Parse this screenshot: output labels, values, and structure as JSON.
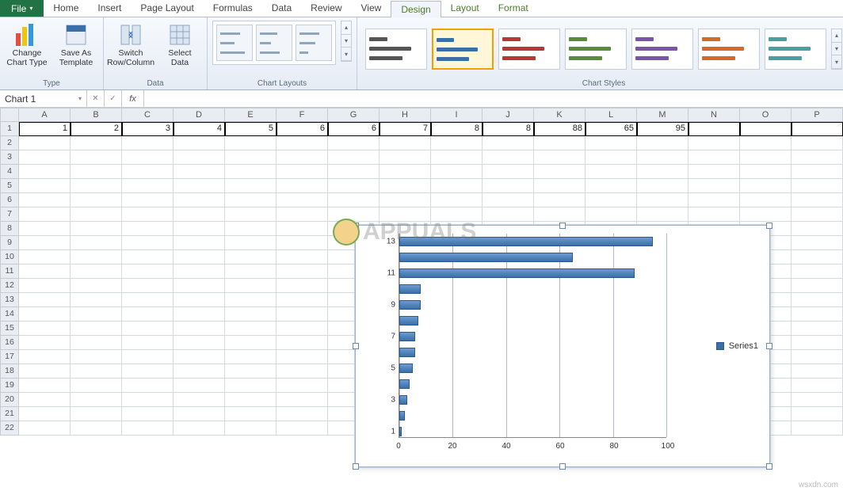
{
  "tabs": {
    "file": "File",
    "list": [
      "Home",
      "Insert",
      "Page Layout",
      "Formulas",
      "Data",
      "Review",
      "View",
      "Design",
      "Layout",
      "Format"
    ],
    "active": "Design",
    "context_start_index": 7
  },
  "ribbon": {
    "type_group": {
      "label": "Type",
      "change_chart": "Change Chart Type",
      "save_template": "Save As Template"
    },
    "data_group": {
      "label": "Data",
      "switch": "Switch Row/Column",
      "select": "Select Data"
    },
    "layouts_group": {
      "label": "Chart Layouts"
    },
    "styles_group": {
      "label": "Chart Styles"
    },
    "style_colors": [
      "#555555",
      "#3b6fa8",
      "#b43838",
      "#5a8a3a",
      "#7a54a8",
      "#d46a2a",
      "#4aa0a0"
    ],
    "selected_style_index": 1
  },
  "name_box": "Chart 1",
  "fx_label": "fx",
  "sheet": {
    "columns": [
      "A",
      "B",
      "C",
      "D",
      "E",
      "F",
      "G",
      "H",
      "I",
      "J",
      "K",
      "L",
      "M",
      "N",
      "O",
      "P"
    ],
    "row1_values": [
      1,
      2,
      3,
      4,
      5,
      6,
      6,
      7,
      8,
      8,
      88,
      65,
      95
    ],
    "visible_rows": 22
  },
  "chart_data": {
    "type": "bar",
    "categories": [
      1,
      2,
      3,
      4,
      5,
      6,
      7,
      8,
      9,
      10,
      11,
      12,
      13
    ],
    "values": [
      1,
      2,
      3,
      4,
      5,
      6,
      6,
      7,
      8,
      8,
      88,
      65,
      95
    ],
    "series_name": "Series1",
    "xlim": [
      0,
      100
    ],
    "x_ticks": [
      0,
      20,
      40,
      60,
      80,
      100
    ],
    "y_tick_labels": [
      1,
      3,
      5,
      7,
      9,
      11,
      13
    ]
  },
  "watermark": "APPUALS",
  "credit": "wsxdn.com"
}
